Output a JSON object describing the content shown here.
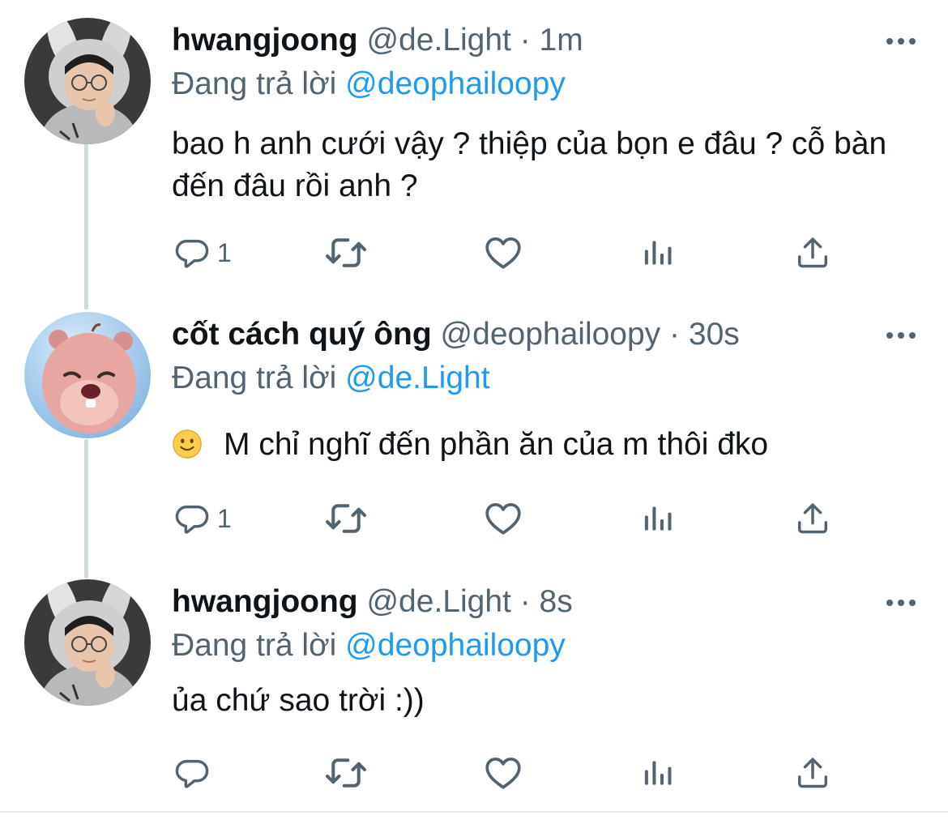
{
  "thread": {
    "tweets": [
      {
        "name": "hwangjoong",
        "handle": "@de.Light",
        "separator": "·",
        "time": "1m",
        "reply_prefix": "Đang trả lời",
        "reply_to": "@deophailoopy",
        "text": "bao h anh cưới vậy ? thiệp của bọn e đâu ? cỗ bàn đến đâu rồi anh ?",
        "reply_count": "1"
      },
      {
        "name": "cốt cách quý ông",
        "handle": "@deophailoopy",
        "separator": "·",
        "time": "30s",
        "reply_prefix": "Đang trả lời",
        "reply_to": "@de.Light",
        "text": "M chỉ nghĩ đến phần ăn của m thôi đko",
        "reply_count": "1"
      },
      {
        "name": "hwangjoong",
        "handle": "@de.Light",
        "separator": "·",
        "time": "8s",
        "reply_prefix": "Đang trả lời",
        "reply_to": "@deophailoopy",
        "text": "ủa chứ sao trời :))",
        "reply_count": ""
      }
    ]
  },
  "icons": {
    "reply": "comment-bubble-icon",
    "retweet": "retweet-icon",
    "like": "heart-icon",
    "views": "analytics-bars-icon",
    "share": "share-upload-icon",
    "more": "more-dots-icon",
    "emoji": "slightly-smiling-face-emoji"
  },
  "colors": {
    "text": "#0f1419",
    "secondary": "#536471",
    "link": "#1d9bf0",
    "thread_line": "#cfd9de"
  }
}
